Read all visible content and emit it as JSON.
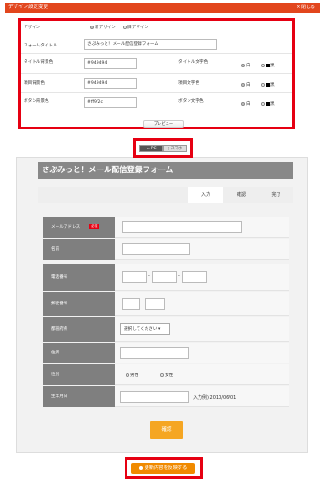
{
  "window": {
    "title": "デザイン設定変更",
    "close_label": "× 閉じる"
  },
  "settings": {
    "design_label": "デザイン",
    "design_options": [
      "新デザイン",
      "旧デザイン"
    ],
    "form_title_label": "フォームタイトル",
    "form_title_value": "さぷみっと！メール配信登録フォーム",
    "title_bg_label": "タイトル背景色",
    "title_bg_value": "#949494",
    "title_text_color_label": "タイトル文字色",
    "item_bg_label": "項目背景色",
    "item_bg_value": "#949494",
    "item_text_color_label": "項目文字色",
    "button_bg_label": "ボタン背景色",
    "button_bg_value": "#ff9f2c",
    "button_text_color_label": "ボタン文字色",
    "color_options": [
      "白",
      "黒"
    ],
    "preview_label": "プレビュー"
  },
  "device": {
    "pc_label": "PC",
    "sp_label": "スマホ"
  },
  "form": {
    "title": "さぷみっと！メール配信登録フォーム",
    "steps": [
      "入力",
      "確認",
      "完了"
    ],
    "required_badge": "必須",
    "rows": [
      {
        "label": "メールアドレス"
      },
      {
        "label": "名前"
      },
      {
        "label": "電話番号"
      },
      {
        "label": "郵便番号"
      },
      {
        "label": "都道府県"
      },
      {
        "label": "住所"
      },
      {
        "label": "性別"
      },
      {
        "label": "生年月日"
      }
    ],
    "prefecture_placeholder": "選択してください",
    "gender_options": [
      "男性",
      "女性"
    ],
    "birthday_example": "入力例) 2010/06/01",
    "confirm_label": "確認"
  },
  "apply_label": "更新内容を反映する",
  "colors": {
    "accent_red": "#e60012",
    "header_gray": "#888888",
    "button_orange": "#f5a623",
    "title_bar": "#e2461d"
  }
}
